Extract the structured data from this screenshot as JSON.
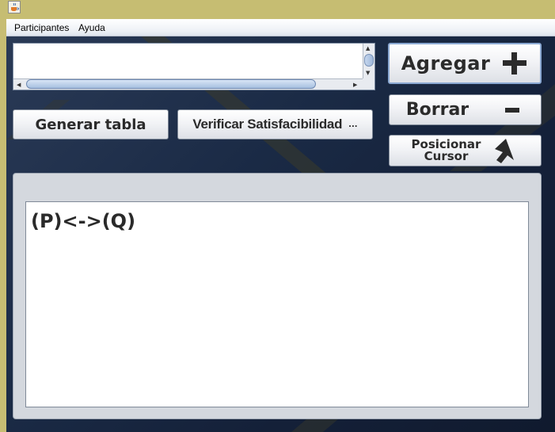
{
  "window": {
    "icon": "java-cup-icon"
  },
  "menu": {
    "items": [
      "Participantes",
      "Ayuda"
    ]
  },
  "input": {
    "value": ""
  },
  "buttons": {
    "agregar": {
      "label": "Agregar",
      "icon": "plus-icon"
    },
    "borrar": {
      "label": "Borrar",
      "icon": "minus-icon"
    },
    "posicionar": {
      "line1": "Posicionar",
      "line2": "Cursor",
      "icon": "cursor-arrow-icon"
    },
    "generar": {
      "label": "Generar tabla"
    },
    "verificar": {
      "label": "Verificar Satisfacibilidad",
      "ellipsis": "..."
    }
  },
  "output": {
    "formula": "(P)<->(Q)"
  },
  "colors": {
    "title_bar": "#c6bd72",
    "background": "#18243a",
    "button_face": "#f2f3f6",
    "accent_border": "#8aa8d2"
  }
}
